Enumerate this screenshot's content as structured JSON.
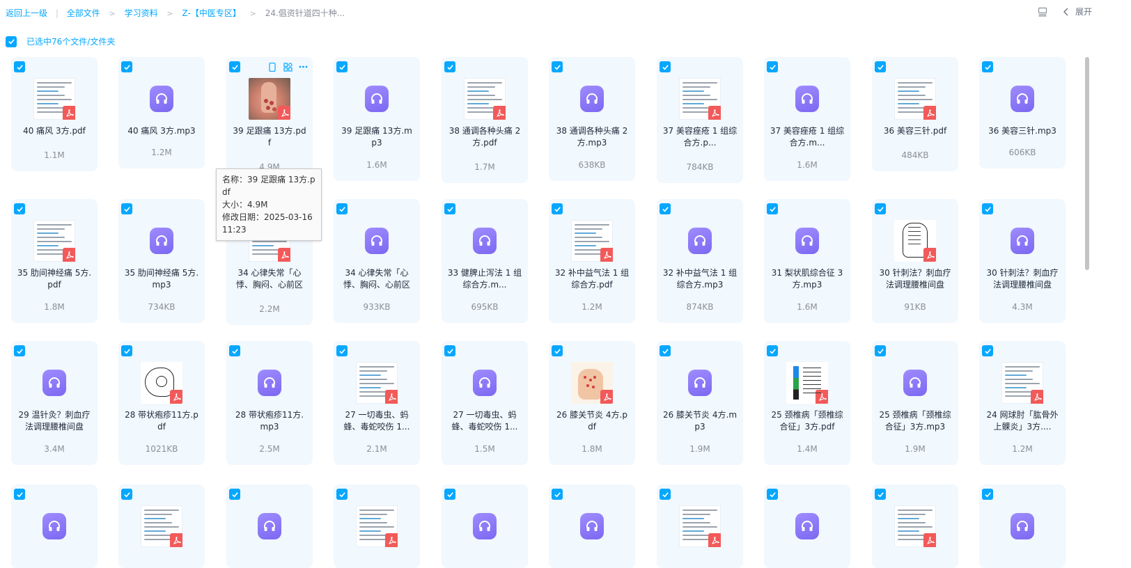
{
  "breadcrumb": {
    "back": "返回上一级",
    "items": [
      "全部文件",
      "学习资料",
      "Z-【中医专区】"
    ],
    "current": "24.倡资针道四十种..."
  },
  "toolbar": {
    "expand_label": "展开"
  },
  "selection": {
    "label": "已选中76个文件/文件夹"
  },
  "tooltip": {
    "name": "名称：39 足跟痛 13方.pdf",
    "size": "大小：4.9M",
    "date": "修改日期：2025-03-16 11:23"
  },
  "files": [
    {
      "name": "40 痛风 3方.pdf",
      "size": "1.1M",
      "type": "pdf"
    },
    {
      "name": "40 痛风 3方.mp3",
      "size": "1.2M",
      "type": "mp3"
    },
    {
      "name": "39 足跟痛 13方.pdf",
      "size": "4.9M",
      "type": "pdf",
      "thumb": "hand-photo"
    },
    {
      "name": "39 足跟痛 13方.mp3",
      "size": "1.6M",
      "type": "mp3"
    },
    {
      "name": "38 通调各种头痛 2方.pdf",
      "size": "1.7M",
      "type": "pdf"
    },
    {
      "name": "38 通调各种头痛 2方.mp3",
      "size": "638KB",
      "type": "mp3"
    },
    {
      "name": "37 美容痤疮 1 组综合方.p...",
      "size": "784KB",
      "type": "pdf"
    },
    {
      "name": "37 美容痤疮 1 组综合方.m...",
      "size": "1.6M",
      "type": "mp3"
    },
    {
      "name": "36 美容三针.pdf",
      "size": "484KB",
      "type": "pdf"
    },
    {
      "name": "36 美容三针.mp3",
      "size": "606KB",
      "type": "mp3"
    },
    {
      "name": "35 肋间神经痛 5方.pdf",
      "size": "1.8M",
      "type": "pdf"
    },
    {
      "name": "35 肋间神经痛 5方.mp3",
      "size": "734KB",
      "type": "mp3"
    },
    {
      "name": "34 心律失常「心悸、胸闷、心前区",
      "size": "2.2M",
      "type": "pdf"
    },
    {
      "name": "34 心律失常「心悸、胸闷、心前区",
      "size": "933KB",
      "type": "mp3"
    },
    {
      "name": "33 健脾止泻法 1 组综合方.m...",
      "size": "695KB",
      "type": "mp3"
    },
    {
      "name": "32 补中益气法 1 组综合方.pdf",
      "size": "1.2M",
      "type": "pdf"
    },
    {
      "name": "32 补中益气法 1 组综合方.mp3",
      "size": "874KB",
      "type": "mp3"
    },
    {
      "name": "31 梨状肌综合征 3方.mp3",
      "size": "1.6M",
      "type": "mp3"
    },
    {
      "name": "30 针刺法？刺血疗法调理腰椎间盘",
      "size": "91KB",
      "type": "pdf",
      "thumb": "hand-sketch"
    },
    {
      "name": "30 针刺法？刺血疗法调理腰椎间盘",
      "size": "4.3M",
      "type": "mp3"
    },
    {
      "name": "29 温针灸？刺血疗法调理腰椎间盘",
      "size": "3.4M",
      "type": "mp3"
    },
    {
      "name": "28 带状疱疹11方.pdf",
      "size": "1021KB",
      "type": "pdf",
      "thumb": "knee-sketch"
    },
    {
      "name": "28 带状疱疹11方.mp3",
      "size": "2.5M",
      "type": "mp3"
    },
    {
      "name": "27 一切毒虫、蚂蜂、毒蛇咬伤 1...",
      "size": "2.1M",
      "type": "pdf"
    },
    {
      "name": "27 一切毒虫、蚂蜂、毒蛇咬伤 1...",
      "size": "1.5M",
      "type": "mp3"
    },
    {
      "name": "26 膝关节炎 4方.pdf",
      "size": "1.8M",
      "type": "pdf",
      "thumb": "hand-color"
    },
    {
      "name": "26 膝关节炎 4方.mp3",
      "size": "1.9M",
      "type": "mp3"
    },
    {
      "name": "25 颈椎病「颈椎综合征」3方.pdf",
      "size": "1.4M",
      "type": "pdf",
      "thumb": "chart-thumb"
    },
    {
      "name": "25 颈椎病「颈椎综合征」3方.mp3",
      "size": "1.9M",
      "type": "mp3"
    },
    {
      "name": "24 网球肘「肱骨外上髁炎」3方....",
      "size": "1.2M",
      "type": "pdf"
    },
    {
      "name": "",
      "size": "",
      "type": "mp3"
    },
    {
      "name": "",
      "size": "",
      "type": "pdf"
    },
    {
      "name": "",
      "size": "",
      "type": "mp3"
    },
    {
      "name": "",
      "size": "",
      "type": "pdf"
    },
    {
      "name": "",
      "size": "",
      "type": "mp3"
    },
    {
      "name": "",
      "size": "",
      "type": "mp3"
    },
    {
      "name": "",
      "size": "",
      "type": "pdf"
    },
    {
      "name": "",
      "size": "",
      "type": "mp3"
    },
    {
      "name": "",
      "size": "",
      "type": "pdf"
    },
    {
      "name": "",
      "size": "",
      "type": "mp3"
    }
  ],
  "colors": {
    "accent": "#06a7ff",
    "card_bg": "#f1f8fe",
    "audio": "#8473f7",
    "pdf": "#f25a5a"
  }
}
